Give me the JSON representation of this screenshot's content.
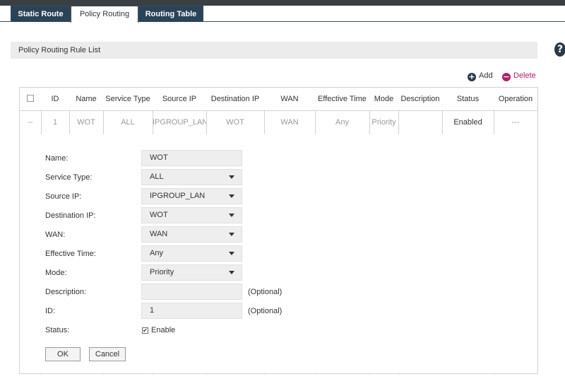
{
  "tabs": [
    {
      "label": "Static Route",
      "state": "inactive"
    },
    {
      "label": "Policy Routing",
      "state": "active"
    },
    {
      "label": "Routing Table",
      "state": "inactive"
    }
  ],
  "help_icon": "question-circle-icon",
  "section_title": "Policy Routing Rule List",
  "actions": {
    "add_label": "Add",
    "delete_label": "Delete",
    "add_icon": "plus-circle-icon",
    "delete_icon": "minus-circle-icon"
  },
  "table": {
    "headers": [
      "ID",
      "Name",
      "Service Type",
      "Source IP",
      "Destination IP",
      "WAN",
      "Effective Time",
      "Mode",
      "Description",
      "Status",
      "Operation"
    ],
    "rows": [
      {
        "select": "--",
        "id": "1",
        "name": "WOT",
        "service_type": "ALL",
        "source_ip": "IPGROUP_LAN",
        "destination_ip": "WOT",
        "wan": "WAN",
        "effective_time": "Any",
        "mode": "Priority",
        "description": "",
        "status": "Enabled",
        "operation": "---"
      }
    ]
  },
  "form": {
    "name": {
      "label": "Name:",
      "value": "WOT"
    },
    "service_type": {
      "label": "Service Type:",
      "value": "ALL"
    },
    "source_ip": {
      "label": "Source IP:",
      "value": "IPGROUP_LAN"
    },
    "destination_ip": {
      "label": "Destination IP:",
      "value": "WOT"
    },
    "wan": {
      "label": "WAN:",
      "value": "WAN"
    },
    "effective_time": {
      "label": "Effective Time:",
      "value": "Any"
    },
    "mode": {
      "label": "Mode:",
      "value": "Priority"
    },
    "description": {
      "label": "Description:",
      "value": "",
      "hint": "(Optional)"
    },
    "id": {
      "label": "ID:",
      "value": "1",
      "hint": "(Optional)"
    },
    "status": {
      "label": "Status:",
      "checkbox_label": "Enable",
      "checked": true
    }
  },
  "buttons": {
    "ok": "OK",
    "cancel": "Cancel"
  },
  "colors": {
    "tab_dark": "#2b4357",
    "delete": "#b01f6b",
    "field_bg": "#eeeeee",
    "section_bg": "#ececec"
  }
}
